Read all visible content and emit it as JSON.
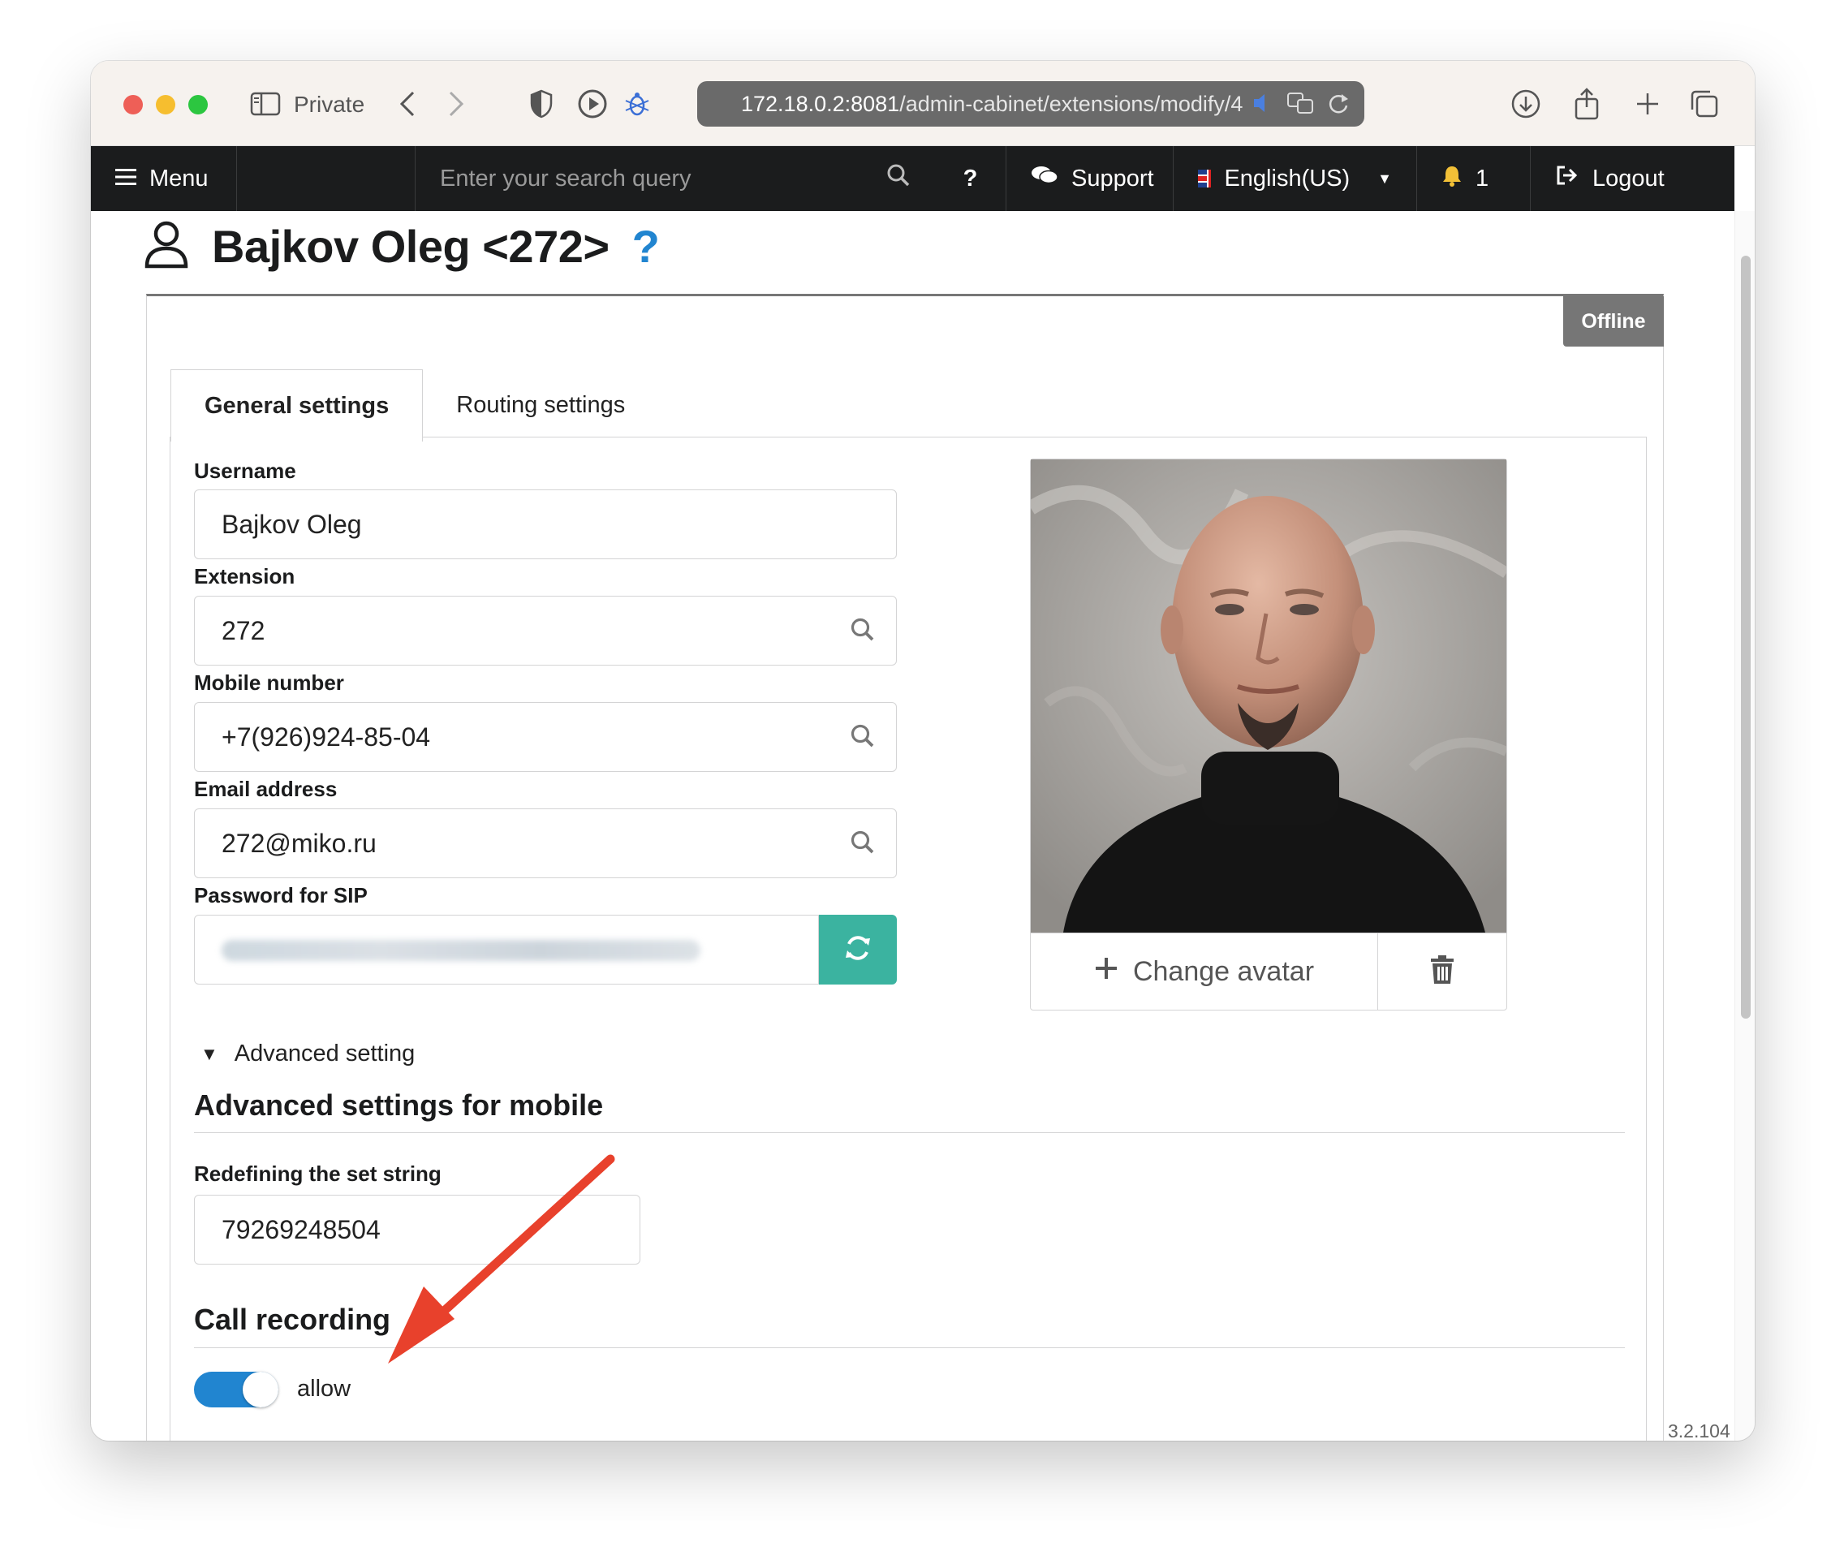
{
  "browser": {
    "private_label": "Private",
    "url_host": "172.18.0.2:8081",
    "url_path": "/admin-cabinet/extensions/modify/4"
  },
  "nav": {
    "menu_label": "Menu",
    "search_placeholder": "Enter your search query",
    "help_label": "?",
    "support_label": "Support",
    "language_label": "English(US)",
    "notifications_count": "1",
    "logout_label": "Logout"
  },
  "page": {
    "title": "Bajkov Oleg <272>",
    "help_label": "?",
    "status_badge": "Offline"
  },
  "tabs": [
    {
      "label": "General settings",
      "active": true
    },
    {
      "label": "Routing settings",
      "active": false
    }
  ],
  "form": {
    "username": {
      "label": "Username",
      "value": "Bajkov Oleg"
    },
    "extension": {
      "label": "Extension",
      "value": "272"
    },
    "mobile": {
      "label": "Mobile number",
      "value": "+7(926)924-85-04"
    },
    "email": {
      "label": "Email address",
      "value": "272@miko.ru"
    },
    "sip_password": {
      "label": "Password for SIP"
    }
  },
  "avatar": {
    "change_label": "Change avatar"
  },
  "advanced": {
    "toggle_label": "Advanced setting",
    "mobile_section_title": "Advanced settings for mobile",
    "dial_string_label": "Redefining the set string",
    "dial_string_value": "79269248504",
    "recording_section_title": "Call recording",
    "recording_toggle_label": "allow",
    "recording_enabled": true
  },
  "footer": {
    "version": "3.2.104"
  },
  "colors": {
    "accent": "#2185d0",
    "nav_bg": "#1b1c1d",
    "regen_button": "#3bb3a0",
    "offline_badge": "#767676",
    "annotation_arrow": "#e8412c"
  }
}
